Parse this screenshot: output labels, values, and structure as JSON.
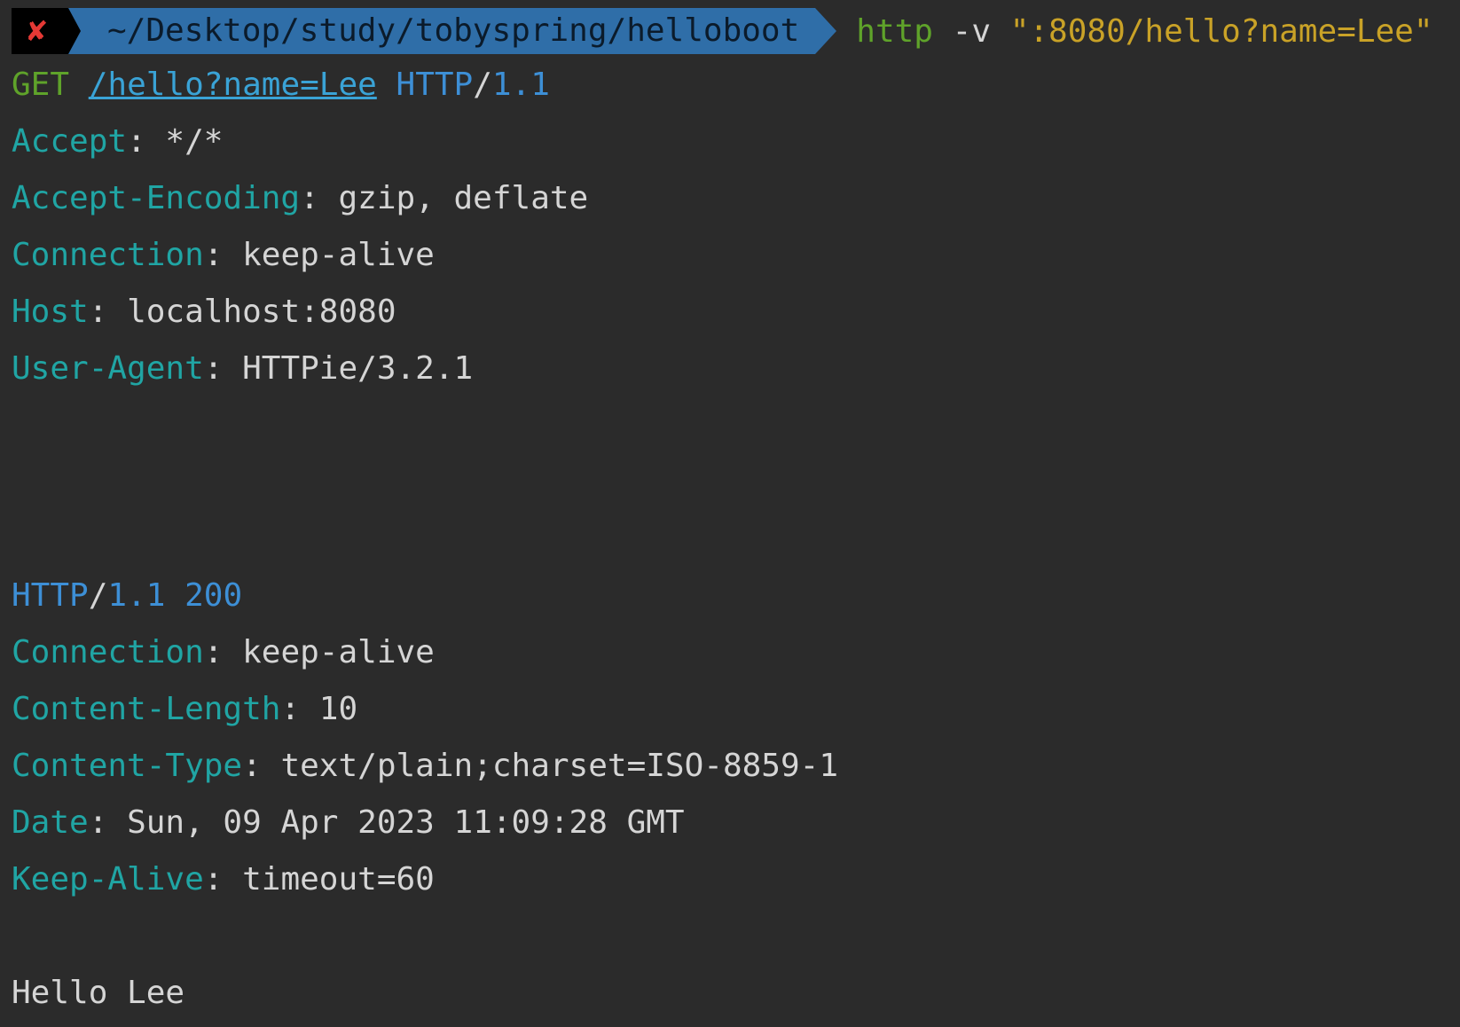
{
  "prompt": {
    "status_glyph": "✘",
    "path": "~/Desktop/study/tobyspring/helloboot",
    "command": "http",
    "flag": "-v",
    "argument": "\":8080/hello?name=Lee\""
  },
  "request": {
    "method": "GET",
    "path": "/hello?name=Lee",
    "protocol": "HTTP",
    "slash": "/",
    "version": "1.1",
    "headers": [
      {
        "key": "Accept",
        "sep": ": ",
        "value": "*/*"
      },
      {
        "key": "Accept-Encoding",
        "sep": ": ",
        "value": "gzip, deflate"
      },
      {
        "key": "Connection",
        "sep": ": ",
        "value": "keep-alive"
      },
      {
        "key": "Host",
        "sep": ": ",
        "value": "localhost:8080"
      },
      {
        "key": "User-Agent",
        "sep": ": ",
        "value": "HTTPie/3.2.1"
      }
    ]
  },
  "response": {
    "protocol": "HTTP",
    "slash": "/",
    "version": "1.1",
    "status": "200",
    "headers": [
      {
        "key": "Connection",
        "sep": ": ",
        "value": "keep-alive"
      },
      {
        "key": "Content-Length",
        "sep": ": ",
        "value": "10"
      },
      {
        "key": "Content-Type",
        "sep": ": ",
        "value": "text/plain;charset=ISO-8859-1"
      },
      {
        "key": "Date",
        "sep": ": ",
        "value": "Sun, 09 Apr 2023 11:09:28 GMT"
      },
      {
        "key": "Keep-Alive",
        "sep": ": ",
        "value": "timeout=60"
      }
    ],
    "body": "Hello Lee"
  },
  "colors": {
    "background": "#2b2b2b",
    "header_key": "#20a5a4",
    "method": "#5fa32a",
    "protocol": "#3d8fd6",
    "string": "#c9a227",
    "error": "#e53935",
    "path_segment": "#2f6ea8"
  }
}
